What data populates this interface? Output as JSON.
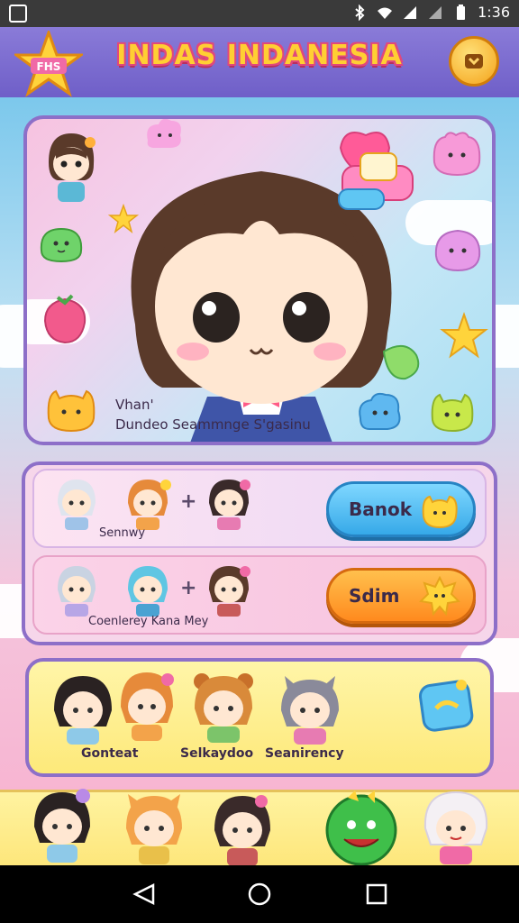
{
  "status_bar": {
    "time": "1:36"
  },
  "header": {
    "title": "INDAS INDANESIA",
    "badge_text": "FHS"
  },
  "hero": {
    "caption_line1": "Vhan'",
    "caption_line2": "Dundeo Seammnge S'gasinu"
  },
  "rows": [
    {
      "label": "Sennwy",
      "button_label": "Banok",
      "button_color": "#36a9e8"
    },
    {
      "label": "Coenlerey Kana Mey",
      "button_label": "Sdim",
      "button_color": "#ff8a1e"
    }
  ],
  "characters_panel": {
    "labels": [
      "Gonteat",
      "Selkaydoo",
      "Seanirency"
    ]
  },
  "colors": {
    "header": "#7a6bd0",
    "title": "#ffcf33",
    "panel_border": "#8d6fc8",
    "yellow_panel": "#fde97a"
  },
  "icons": {
    "home": "home-icon",
    "back": "back-icon",
    "recents": "recents-icon",
    "coin": "coin-icon"
  }
}
